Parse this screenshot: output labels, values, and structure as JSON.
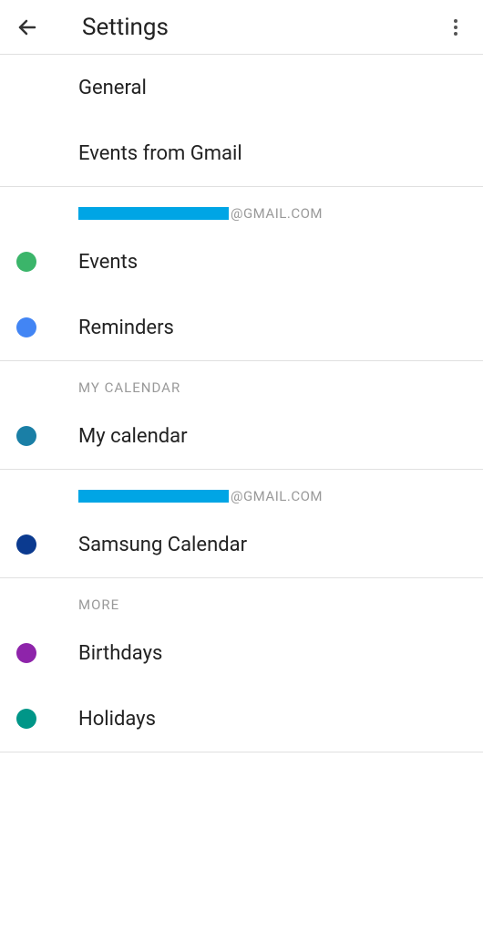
{
  "header": {
    "title": "Settings"
  },
  "sections": {
    "general": {
      "label": "General"
    },
    "events_from_gmail": {
      "label": "Events from Gmail"
    },
    "account1": {
      "email_suffix": "@GMAIL.COM",
      "events": {
        "label": "Events",
        "color": "#3bb56a"
      },
      "reminders": {
        "label": "Reminders",
        "color": "#4285f4"
      }
    },
    "my_calendar_section": {
      "header": "MY CALENDAR",
      "my_calendar": {
        "label": "My calendar",
        "color": "#1a7fa6"
      }
    },
    "account2": {
      "email_suffix": "@GMAIL.COM",
      "samsung_calendar": {
        "label": "Samsung Calendar",
        "color": "#0b3a8f"
      }
    },
    "more": {
      "header": "MORE",
      "birthdays": {
        "label": "Birthdays",
        "color": "#8e24aa"
      },
      "holidays": {
        "label": "Holidays",
        "color": "#009688"
      }
    }
  }
}
